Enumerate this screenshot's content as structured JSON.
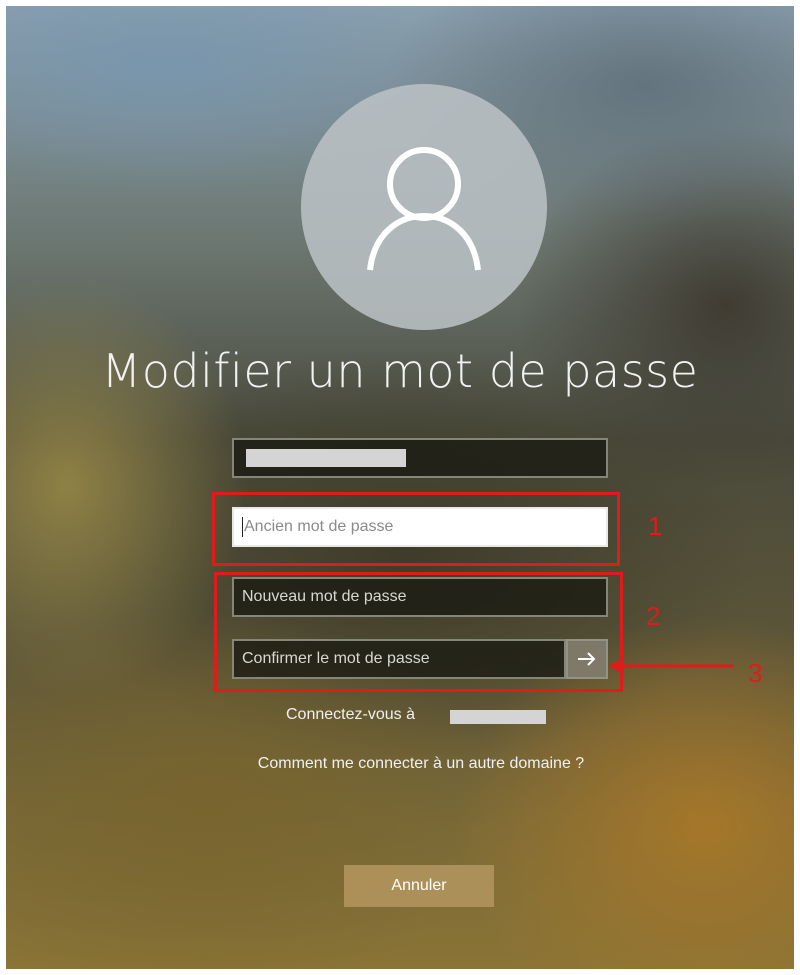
{
  "screen": {
    "title": "Modifier un mot de passe"
  },
  "avatar": {
    "icon": "user-icon"
  },
  "fields": {
    "old_password_placeholder": "Ancien mot de passe",
    "new_password_placeholder": "Nouveau mot de passe",
    "confirm_password_placeholder": "Confirmer le mot de passe",
    "submit_icon": "arrow-right-icon"
  },
  "annotations": {
    "label_1": "1",
    "label_2": "2",
    "label_3": "3",
    "color": "#e01b1b"
  },
  "links": {
    "connect_to": "Connectez-vous à",
    "other_domain": "Comment me connecter à un autre domaine ?"
  },
  "buttons": {
    "cancel": "Annuler"
  }
}
